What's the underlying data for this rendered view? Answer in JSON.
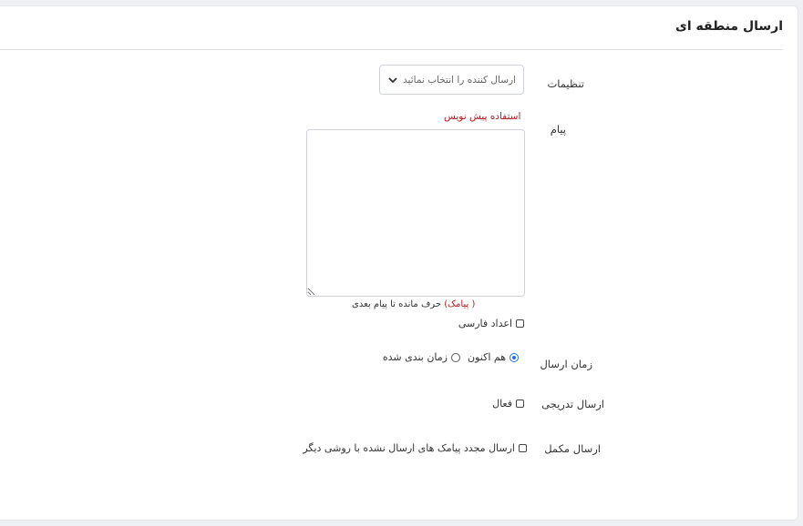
{
  "card": {
    "title": "ارسال منطقه ای"
  },
  "settings": {
    "label": "تنظیمات",
    "sender_select": "ارسال کننده را انتخاب نمائید"
  },
  "message": {
    "label": "پیام",
    "template_link": "استفاده پیش نویس",
    "value": "",
    "counter_sms": "( پیامک)",
    "counter_text": "حرف مانده تا پیام بعدی"
  },
  "persian_numbers": {
    "label": "اعداد فارسی",
    "checked": false
  },
  "send_time": {
    "label": "زمان ارسال",
    "options": [
      {
        "label": "هم اکنون",
        "selected": true
      },
      {
        "label": "زمان بندی شده",
        "selected": false
      }
    ]
  },
  "gradual_send": {
    "label": "ارسال تدریجی",
    "option": "فعال",
    "checked": false
  },
  "complementary_send": {
    "label": "ارسال مکمل",
    "option": "ارسال مجدد پیامک های ارسال نشده با روشی دیگر",
    "checked": false
  }
}
